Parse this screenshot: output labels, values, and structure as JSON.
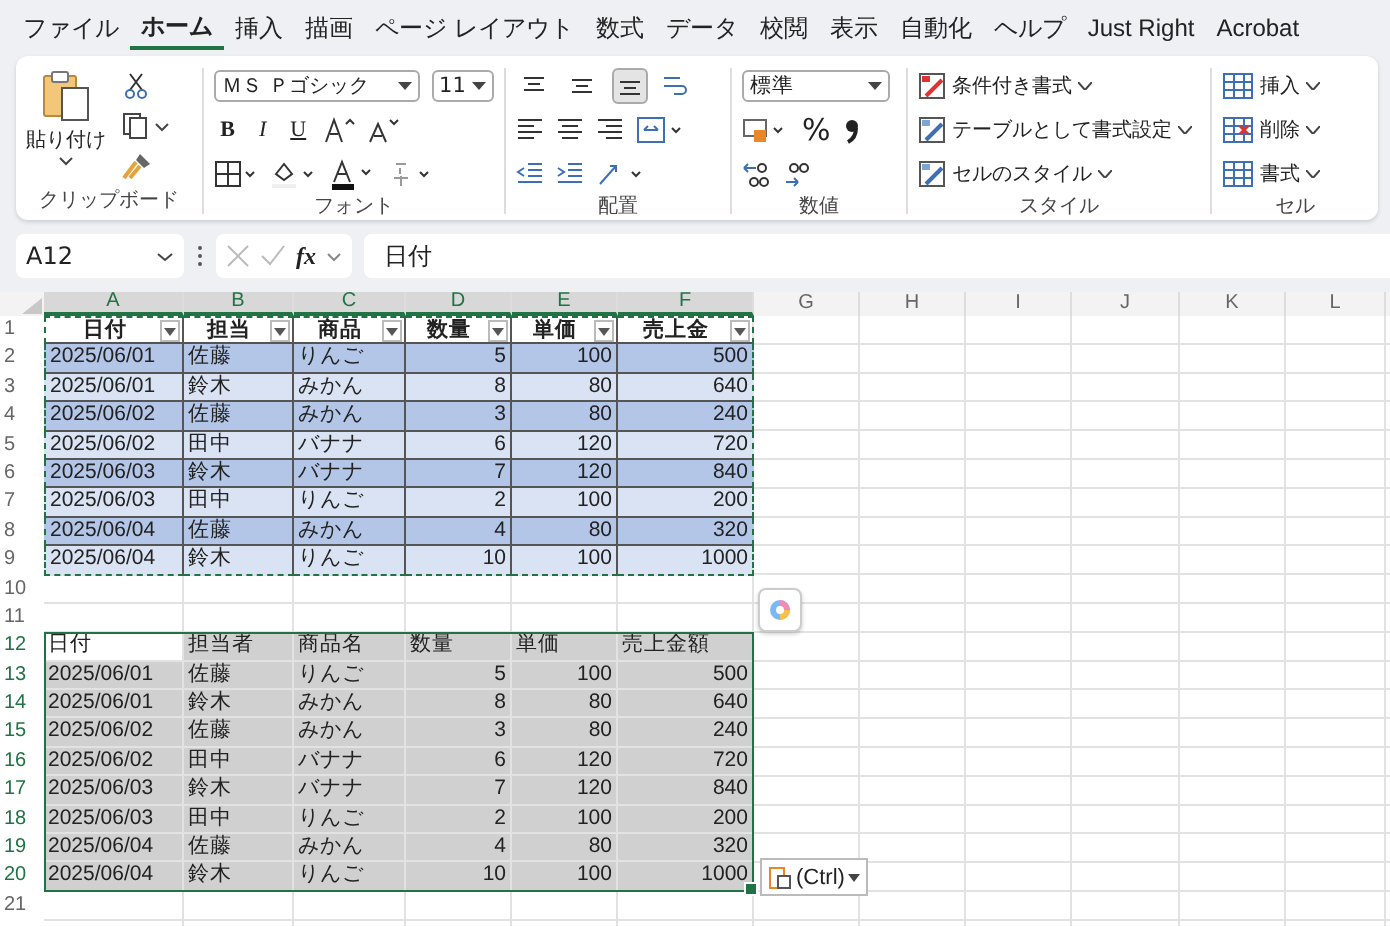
{
  "menu_tabs": [
    {
      "label": "ファイル",
      "selected": false
    },
    {
      "label": "ホーム",
      "selected": true
    },
    {
      "label": "挿入",
      "selected": false
    },
    {
      "label": "描画",
      "selected": false
    },
    {
      "label": "ページ レイアウト",
      "selected": false
    },
    {
      "label": "数式",
      "selected": false
    },
    {
      "label": "データ",
      "selected": false
    },
    {
      "label": "校閲",
      "selected": false
    },
    {
      "label": "表示",
      "selected": false
    },
    {
      "label": "自動化",
      "selected": false
    },
    {
      "label": "ヘルプ",
      "selected": false
    },
    {
      "label": "Just Right",
      "selected": false
    },
    {
      "label": "Acrobat",
      "selected": false
    }
  ],
  "ribbon": {
    "clipboard": {
      "paste_label": "貼り付け",
      "group_label": "クリップボード"
    },
    "font": {
      "font_name": "ＭＳ Ｐゴシック",
      "font_size": "11",
      "style_buttons": [
        "B",
        "I",
        "U"
      ],
      "group_label": "フォント"
    },
    "alignment": {
      "vertical_buttons": [
        {
          "selected": false
        },
        {
          "selected": false
        },
        {
          "selected": true
        }
      ],
      "group_label": "配置"
    },
    "number": {
      "format": "標準",
      "percent": "%",
      "group_label": "数値"
    },
    "styles": {
      "commands": [
        "条件付き書式",
        "テーブルとして書式設定",
        "セルのスタイル"
      ],
      "group_label": "スタイル"
    },
    "cells": {
      "commands": [
        "挿入",
        "削除",
        "書式"
      ],
      "group_label": "セル"
    }
  },
  "name_box": "A12",
  "formula_button": "fx",
  "formula": "日付",
  "sheet": {
    "columns": [
      {
        "label": "A",
        "selected": true
      },
      {
        "label": "B",
        "selected": true
      },
      {
        "label": "C",
        "selected": true
      },
      {
        "label": "D",
        "selected": true
      },
      {
        "label": "E",
        "selected": true
      },
      {
        "label": "F",
        "selected": true
      },
      {
        "label": "G",
        "selected": false
      },
      {
        "label": "H",
        "selected": false
      },
      {
        "label": "I",
        "selected": false
      },
      {
        "label": "J",
        "selected": false
      },
      {
        "label": "K",
        "selected": false
      },
      {
        "label": "L",
        "selected": false
      }
    ],
    "rows": [
      {
        "number": "1",
        "kind": "table_header",
        "selected": false,
        "copied": true,
        "cells": [
          "日付",
          "担当",
          "商品",
          "数量",
          "単価",
          "売上金"
        ]
      },
      {
        "number": "2",
        "kind": "band_dark",
        "selected": false,
        "copied": true,
        "cells": [
          "2025/06/01",
          "佐藤",
          "りんご",
          "5",
          "100",
          "500"
        ]
      },
      {
        "number": "3",
        "kind": "band_light",
        "selected": false,
        "copied": true,
        "cells": [
          "2025/06/01",
          "鈴木",
          "みかん",
          "8",
          "80",
          "640"
        ]
      },
      {
        "number": "4",
        "kind": "band_dark",
        "selected": false,
        "copied": true,
        "cells": [
          "2025/06/02",
          "佐藤",
          "みかん",
          "3",
          "80",
          "240"
        ]
      },
      {
        "number": "5",
        "kind": "band_light",
        "selected": false,
        "copied": true,
        "cells": [
          "2025/06/02",
          "田中",
          "バナナ",
          "6",
          "120",
          "720"
        ]
      },
      {
        "number": "6",
        "kind": "band_dark",
        "selected": false,
        "copied": true,
        "cells": [
          "2025/06/03",
          "鈴木",
          "バナナ",
          "7",
          "120",
          "840"
        ]
      },
      {
        "number": "7",
        "kind": "band_light",
        "selected": false,
        "copied": true,
        "cells": [
          "2025/06/03",
          "田中",
          "りんご",
          "2",
          "100",
          "200"
        ]
      },
      {
        "number": "8",
        "kind": "band_dark",
        "selected": false,
        "copied": true,
        "cells": [
          "2025/06/04",
          "佐藤",
          "みかん",
          "4",
          "80",
          "320"
        ]
      },
      {
        "number": "9",
        "kind": "band_light",
        "selected": false,
        "copied": true,
        "cells": [
          "2025/06/04",
          "鈴木",
          "りんご",
          "10",
          "100",
          "1000"
        ]
      },
      {
        "number": "10",
        "kind": "empty",
        "selected": false,
        "copied": false,
        "cells": []
      },
      {
        "number": "11",
        "kind": "empty",
        "selected": false,
        "copied": false,
        "cells": []
      },
      {
        "number": "12",
        "kind": "plain_header",
        "selected": true,
        "copied": false,
        "cells": [
          "日付",
          "担当者",
          "商品名",
          "数量",
          "単価",
          "売上金額"
        ]
      },
      {
        "number": "13",
        "kind": "plain",
        "selected": true,
        "copied": false,
        "cells": [
          "2025/06/01",
          "佐藤",
          "りんご",
          "5",
          "100",
          "500"
        ]
      },
      {
        "number": "14",
        "kind": "plain",
        "selected": true,
        "copied": false,
        "cells": [
          "2025/06/01",
          "鈴木",
          "みかん",
          "8",
          "80",
          "640"
        ]
      },
      {
        "number": "15",
        "kind": "plain",
        "selected": true,
        "copied": false,
        "cells": [
          "2025/06/02",
          "佐藤",
          "みかん",
          "3",
          "80",
          "240"
        ]
      },
      {
        "number": "16",
        "kind": "plain",
        "selected": true,
        "copied": false,
        "cells": [
          "2025/06/02",
          "田中",
          "バナナ",
          "6",
          "120",
          "720"
        ]
      },
      {
        "number": "17",
        "kind": "plain",
        "selected": true,
        "copied": false,
        "cells": [
          "2025/06/03",
          "鈴木",
          "バナナ",
          "7",
          "120",
          "840"
        ]
      },
      {
        "number": "18",
        "kind": "plain",
        "selected": true,
        "copied": false,
        "cells": [
          "2025/06/03",
          "田中",
          "りんご",
          "2",
          "100",
          "200"
        ]
      },
      {
        "number": "19",
        "kind": "plain",
        "selected": true,
        "copied": false,
        "cells": [
          "2025/06/04",
          "佐藤",
          "みかん",
          "4",
          "80",
          "320"
        ]
      },
      {
        "number": "20",
        "kind": "plain",
        "selected": true,
        "copied": false,
        "cells": [
          "2025/06/04",
          "鈴木",
          "りんご",
          "10",
          "100",
          "1000"
        ]
      },
      {
        "number": "21",
        "kind": "empty",
        "selected": false,
        "copied": false,
        "cells": []
      }
    ]
  },
  "paste_options": "(Ctrl)"
}
